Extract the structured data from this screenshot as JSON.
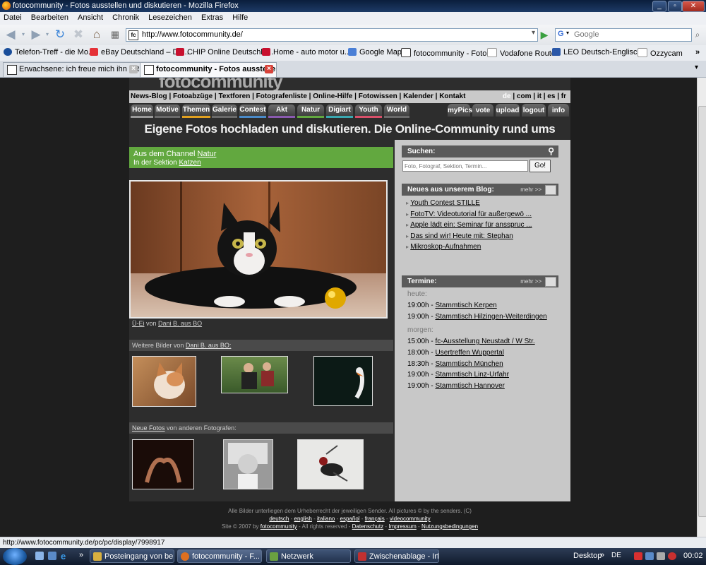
{
  "window": {
    "title": "fotocommunity - Fotos ausstellen und diskutieren - Mozilla Firefox"
  },
  "menu": [
    "Datei",
    "Bearbeiten",
    "Ansicht",
    "Chronik",
    "Lesezeichen",
    "Extras",
    "Hilfe"
  ],
  "toolbar": {
    "url": "http://www.fotocommunity.de/",
    "search_placeholder": "Google"
  },
  "bookmarks": [
    {
      "label": "Telefon-Treff - die Mo...",
      "icon": "tt-icon",
      "color": "#1a4e9a"
    },
    {
      "label": "eBay Deutschland – De...",
      "icon": "ebay-icon",
      "color": "#e53238"
    },
    {
      "label": "CHIP Online Deutschla...",
      "icon": "chip-icon",
      "color": "#c8102e"
    },
    {
      "label": "Home - auto motor u...",
      "icon": "ams-icon",
      "color": "#c8102e"
    },
    {
      "label": "Google Maps",
      "icon": "google-icon",
      "color": "#4a7fd6"
    },
    {
      "label": "fotocommunity - Foto...",
      "icon": "fc-icon",
      "color": "#ffffff"
    },
    {
      "label": "Vodafone Router",
      "icon": "page-icon",
      "color": "#ffffff"
    },
    {
      "label": "LEO Deutsch-Englisch...",
      "icon": "leo-icon",
      "color": "#2b58a8"
    },
    {
      "label": "Ozzycam",
      "icon": "page-icon",
      "color": "#ffffff"
    }
  ],
  "tabs": [
    {
      "label": "Erwachsene: ich freue mich ihn FRE...",
      "active": false
    },
    {
      "label": "fotocommunity - Fotos ausstellen...",
      "active": true
    }
  ],
  "site": {
    "logo": "fotocommunity",
    "topnav": "News-Blog | Fotoabzüge | Textforen | Fotografenliste | Online-Hilfe | Fotowissen | Kalender | Kontakt",
    "langs": {
      "active": "de",
      "rest": "| com | it | es | fr"
    },
    "navtabs": [
      {
        "label": "Home",
        "color": "#999999"
      },
      {
        "label": "Motive",
        "color": "#6a6a6a"
      },
      {
        "label": "Themen",
        "color": "#e0a020"
      },
      {
        "label": "Galerie",
        "color": "#6a6a6a"
      },
      {
        "label": "Contest",
        "color": "#4a8ac8"
      },
      {
        "label": "Akt",
        "color": "#8a5ab0"
      },
      {
        "label": "Natur",
        "color": "#62a83f"
      },
      {
        "label": "Digiart",
        "color": "#3aa8b0"
      },
      {
        "label": "Youth",
        "color": "#d8506a"
      },
      {
        "label": "World",
        "color": "#6a6a6a"
      }
    ],
    "icontabs": [
      "myPics",
      "vote",
      "upload",
      "logout",
      "info"
    ],
    "tagline": "Eigene Fotos hochladen und diskutieren. Die Online-Community rund ums Fotografieren.",
    "channel": {
      "prefix": "Aus dem Channel",
      "channel": "Natur",
      "section_prefix": "In der Sektion",
      "section": "Katzen"
    },
    "photo_caption": {
      "title": "Ü-Ei",
      "by": "von",
      "author": "Dani B. aus BO"
    },
    "more_by": {
      "prefix": "Weitere Bilder von",
      "author": "Dani B. aus BO:"
    },
    "new_photos": {
      "link": "Neue Fotos",
      "suffix": "von anderen Fotografen:"
    },
    "search": {
      "heading": "Suchen:",
      "placeholder": "Foto, Fotograf, Sektion, Termin...",
      "button": "Go!"
    },
    "blog": {
      "heading": "Neues aus unserem Blog:",
      "more": "mehr >>",
      "items": [
        "Youth Contest STILLE",
        "FotoTV: Videotutorial für außergewö ...",
        "Apple lädt ein: Seminar für ansspruc ...",
        "Das sind wir! Heute mit: Stephan",
        "Mikroskop-Aufnahmen"
      ]
    },
    "termine": {
      "heading": "Termine:",
      "more": "mehr >>",
      "today_label": "heute:",
      "today": [
        {
          "time": "19:00h -",
          "event": "Stammtisch Kerpen"
        },
        {
          "time": "19:00h -",
          "event": "Stammtisch Hilzingen-Weiterdingen"
        }
      ],
      "tomorrow_label": "morgen:",
      "tomorrow": [
        {
          "time": "15:00h -",
          "event": "fc-Ausstellung Neustadt / W Str."
        },
        {
          "time": "18:00h -",
          "event": "Usertreffen Wuppertal"
        },
        {
          "time": "18:30h -",
          "event": "Stammtisch München"
        },
        {
          "time": "19:00h -",
          "event": "Stammtisch Linz-Urfahr"
        },
        {
          "time": "19:00h -",
          "event": "Stammtisch Hannover"
        }
      ]
    },
    "footer": {
      "line1": "Alle Bilder unterliegen dem Urheberrecht der jeweiligen Sender. All pictures © by the senders. (C)",
      "langs": [
        "deutsch",
        "english",
        "italiano",
        "español",
        "français",
        "videocommunity"
      ],
      "sep": "-",
      "line3_prefix": "Site © 2007 by",
      "brand": "fotocommunity",
      "line3_mid": "- All rights reserved -",
      "links": [
        "Datenschutz",
        "Impressum",
        "Nutzungsbedingungen"
      ]
    }
  },
  "status": "http://www.fotocommunity.de/pc/pc/display/7998917",
  "taskbar": {
    "items": [
      {
        "label": "Posteingang von be...",
        "active": false,
        "color": "#d8b040"
      },
      {
        "label": "fotocommunity - F...",
        "active": true,
        "color": "#e07020"
      },
      {
        "label": "Netzwerk",
        "active": false,
        "color": "#6aa040"
      },
      {
        "label": "Zwischenablage - Irf...",
        "active": false,
        "color": "#c03030"
      }
    ],
    "desktop": "Desktop",
    "lang": "DE",
    "clock": "00:02"
  }
}
